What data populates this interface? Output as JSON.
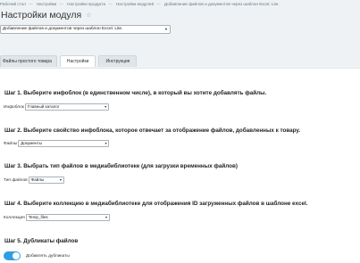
{
  "breadcrumb": [
    "Рабочий стол",
    "Настройки",
    "Настройки продукта",
    "Настройки модулей",
    "Добавление файлов и документов через шаблон Excel. Lite."
  ],
  "page_title": "Настройки модуля",
  "module_select": "Добавление файлов и документов через шаблон Excel. Lite.",
  "tabs": [
    {
      "label": "Файлы простого товара"
    },
    {
      "label": "Настройки"
    },
    {
      "label": "Инструкция"
    }
  ],
  "steps": {
    "s1": {
      "title": "Шаг 1. Выберите инфоблок (в единственном числе), в который вы хотите добавлять файлы.",
      "label": "Инфоблок",
      "value": "Главный каталог"
    },
    "s2": {
      "title": "Шаг 2. Выберите свойство инфоблока, которое отвечает за отображение файлов, добавленных к товару.",
      "label": "Файлы",
      "value": "Документы"
    },
    "s3": {
      "title": "Шаг 3. Выбрать тип файлов в медиабиблиотеке (для загрузки временных файлов)",
      "label": "Тип файлов",
      "value": "Файлы"
    },
    "s4": {
      "title": "Шаг 4. Выберите коллекцию в медиабиблиотеке для отображения ID загруженных файлов в шаблоне excel.",
      "label": "Коллекция",
      "value": "Temp_files"
    },
    "s5": {
      "title": "Шаг 5. Дубликаты файлов",
      "toggle_label": "Добавлять дубликаты",
      "toggle_on": true
    }
  },
  "colors": {
    "accent": "#2f9fe2",
    "background": "#eef2f4"
  }
}
